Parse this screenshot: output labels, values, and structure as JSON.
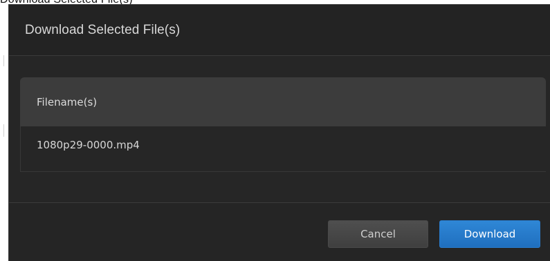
{
  "background_peek_text": "Download Selected File(s)",
  "modal": {
    "title": "Download Selected File(s)",
    "table": {
      "header": "Filename(s)",
      "rows": [
        {
          "filename": "1080p29-0000.mp4"
        }
      ]
    },
    "footer": {
      "cancel_label": "Cancel",
      "download_label": "Download"
    }
  },
  "colors": {
    "modal_bg": "#252525",
    "table_header_bg": "#3c3c3c",
    "download_button": "#2a7bcb",
    "cancel_button": "#474747"
  }
}
